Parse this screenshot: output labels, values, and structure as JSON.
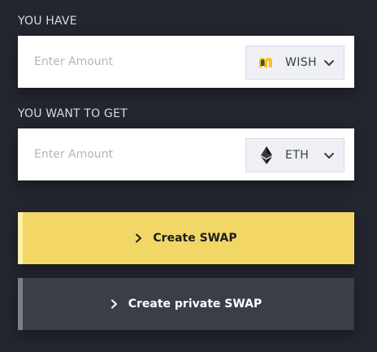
{
  "have": {
    "label": "YOU HAVE",
    "placeholder": "Enter Amount",
    "token": {
      "name": "WISH",
      "icon": "wish-logo-icon"
    }
  },
  "get": {
    "label": "YOU WANT TO GET",
    "placeholder": "Enter Amount",
    "token": {
      "name": "ETH",
      "icon": "ethereum-icon"
    }
  },
  "actions": {
    "create_swap": "Create SWAP",
    "create_private_swap": "Create private SWAP"
  },
  "colors": {
    "background": "#23262e",
    "primary": "#f3d766",
    "secondary": "#3b3e47"
  }
}
